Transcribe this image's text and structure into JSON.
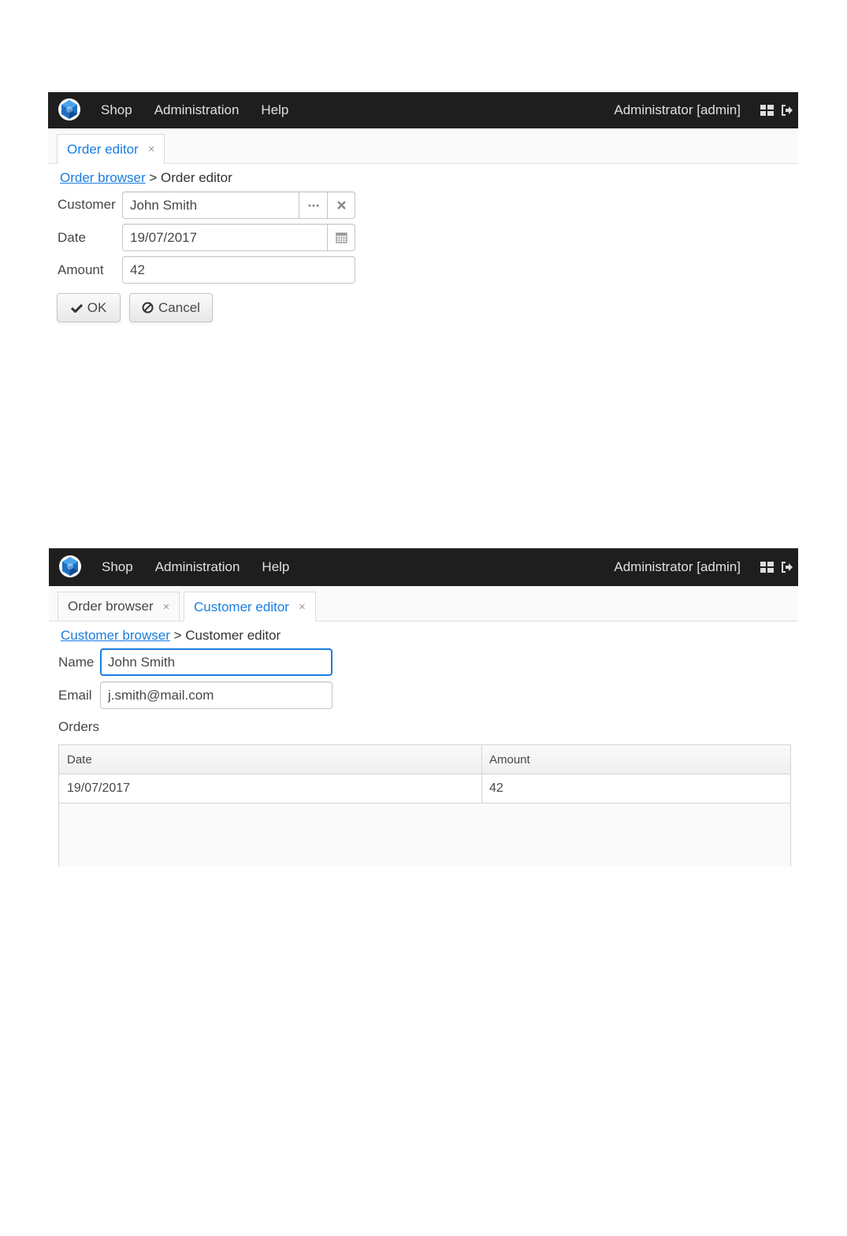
{
  "navbar": {
    "menu": [
      "Shop",
      "Administration",
      "Help"
    ],
    "user": "Administrator [admin]",
    "icons": [
      "app-logo-icon",
      "app-menu-grid-icon",
      "logout-icon"
    ]
  },
  "order_editor_screen": {
    "tabs": [
      {
        "label": "Order editor",
        "close": "×",
        "active": true
      }
    ],
    "breadcrumb": {
      "link": "Order browser",
      "separator": ">",
      "current": "Order editor"
    },
    "fields": {
      "customer": {
        "label": "Customer",
        "value": "John Smith"
      },
      "date": {
        "label": "Date",
        "value": "19/07/2017"
      },
      "amount": {
        "label": "Amount",
        "value": "42"
      }
    },
    "buttons": {
      "ok": "OK",
      "cancel": "Cancel"
    }
  },
  "customer_editor_screen": {
    "tabs": [
      {
        "label": "Order browser",
        "close": "×",
        "active": false
      },
      {
        "label": "Customer editor",
        "close": "×",
        "active": true
      }
    ],
    "breadcrumb": {
      "link": "Customer browser",
      "separator": ">",
      "current": "Customer editor"
    },
    "fields": {
      "name": {
        "label": "Name",
        "value": "John Smith"
      },
      "email": {
        "label": "Email",
        "value": "j.smith@mail.com"
      }
    },
    "orders": {
      "caption": "Orders",
      "columns": [
        "Date",
        "Amount"
      ],
      "rows": [
        [
          "19/07/2017",
          "42"
        ]
      ]
    }
  },
  "colors": {
    "navbar": "#1e1e1e",
    "accent": "#197de1",
    "text": "#464646"
  }
}
